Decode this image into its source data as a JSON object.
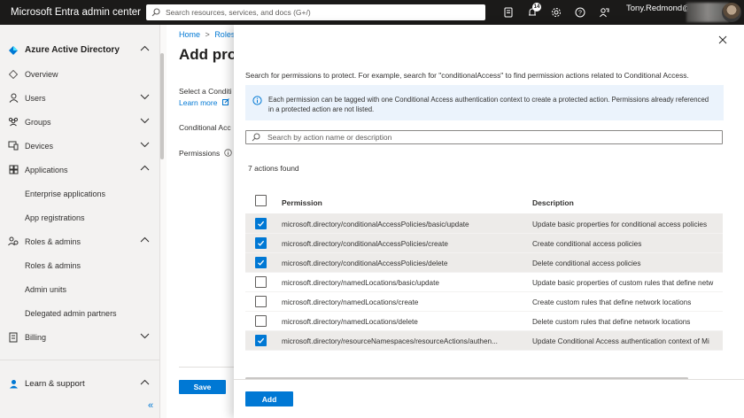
{
  "topbar": {
    "brand": "Microsoft Entra admin center",
    "search_placeholder": "Search resources, services, and docs (G+/)",
    "notification_count": "14",
    "user": "Tony.Redmond@"
  },
  "sidebar": {
    "section_title": "Azure Active Directory",
    "items": [
      {
        "label": "Overview",
        "icon": "diamond-icon"
      },
      {
        "label": "Users",
        "icon": "person-icon",
        "expandable": true
      },
      {
        "label": "Groups",
        "icon": "groups-icon",
        "expandable": true
      },
      {
        "label": "Devices",
        "icon": "devices-icon",
        "expandable": true
      },
      {
        "label": "Applications",
        "icon": "apps-icon",
        "expandable": true,
        "expanded": true
      },
      {
        "label": "Enterprise applications",
        "sub": true
      },
      {
        "label": "App registrations",
        "sub": true
      },
      {
        "label": "Roles & admins",
        "icon": "roles-icon",
        "expandable": true,
        "expanded": true
      },
      {
        "label": "Roles & admins",
        "sub": true
      },
      {
        "label": "Admin units",
        "sub": true
      },
      {
        "label": "Delegated admin partners",
        "sub": true
      },
      {
        "label": "Billing",
        "icon": "billing-icon",
        "expandable": true
      }
    ],
    "learn_support": "Learn & support",
    "collapse_glyph": "«"
  },
  "background_page": {
    "breadcrumb_home": "Home",
    "breadcrumb_sep": ">",
    "breadcrumb_roles": "Roles",
    "title": "Add prot",
    "select_text": "Select a Conditi",
    "learn_more": "Learn more",
    "conditional": "Conditional Acc",
    "permissions": "Permissions",
    "save_label": "Save"
  },
  "panel": {
    "intro": "Search for permissions to protect. For example, search for \"conditionalAccess\" to find permission actions related to Conditional Access.",
    "info": "Each permission can be tagged with one Conditional Access authentication context to create a protected action. Permissions already referenced in a protected action are not listed.",
    "search_placeholder": "Search by action name or description",
    "found": "7 actions found",
    "col_permission": "Permission",
    "col_description": "Description",
    "rows": [
      {
        "permission": "microsoft.directory/conditionalAccessPolicies/basic/update",
        "description": "Update basic properties for conditional access policies",
        "checked": true
      },
      {
        "permission": "microsoft.directory/conditionalAccessPolicies/create",
        "description": "Create conditional access policies",
        "checked": true
      },
      {
        "permission": "microsoft.directory/conditionalAccessPolicies/delete",
        "description": "Delete conditional access policies",
        "checked": true
      },
      {
        "permission": "microsoft.directory/namedLocations/basic/update",
        "description": "Update basic properties of custom rules that define netw",
        "checked": false
      },
      {
        "permission": "microsoft.directory/namedLocations/create",
        "description": "Create custom rules that define network locations",
        "checked": false
      },
      {
        "permission": "microsoft.directory/namedLocations/delete",
        "description": "Delete custom rules that define network locations",
        "checked": false
      },
      {
        "permission": "microsoft.directory/resourceNamespaces/resourceActions/authen...",
        "description": "Update Conditional Access authentication context of Mi",
        "checked": true
      }
    ],
    "add_label": "Add"
  },
  "colors": {
    "accent": "#0078d4",
    "topbar": "#1b1a19",
    "selected_row": "#edebe9"
  }
}
